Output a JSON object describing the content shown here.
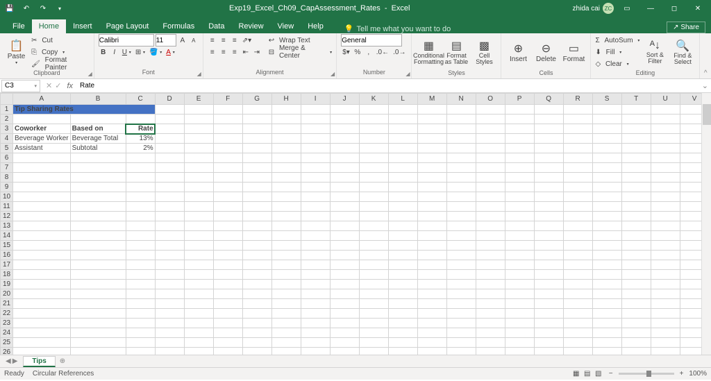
{
  "title_bar": {
    "filename": "Exp19_Excel_Ch09_CapAssessment_Rates",
    "app": "Excel",
    "user_name": "zhida cai",
    "user_initials": "ZC"
  },
  "menu": {
    "tabs": [
      "File",
      "Home",
      "Insert",
      "Page Layout",
      "Formulas",
      "Data",
      "Review",
      "View",
      "Help"
    ],
    "active": "Home",
    "tell_me": "Tell me what you want to do",
    "share": "Share"
  },
  "ribbon": {
    "clipboard": {
      "paste": "Paste",
      "cut": "Cut",
      "copy": "Copy",
      "format_painter": "Format Painter",
      "label": "Clipboard"
    },
    "font": {
      "name": "Calibri",
      "size": "11",
      "label": "Font"
    },
    "alignment": {
      "wrap": "Wrap Text",
      "merge": "Merge & Center",
      "label": "Alignment"
    },
    "number": {
      "format": "General",
      "label": "Number"
    },
    "styles": {
      "conditional": "Conditional Formatting",
      "format_as": "Format as Table",
      "cell": "Cell Styles",
      "label": "Styles"
    },
    "cells": {
      "insert": "Insert",
      "delete": "Delete",
      "format": "Format",
      "label": "Cells"
    },
    "editing": {
      "autosum": "AutoSum",
      "fill": "Fill",
      "clear": "Clear",
      "sort": "Sort & Filter",
      "find": "Find & Select",
      "label": "Editing"
    }
  },
  "formula_bar": {
    "cell_ref": "C3",
    "formula": "Rate"
  },
  "columns": [
    "A",
    "B",
    "C",
    "D",
    "E",
    "F",
    "G",
    "H",
    "I",
    "J",
    "K",
    "L",
    "M",
    "N",
    "O",
    "P",
    "Q",
    "R",
    "S",
    "T",
    "U",
    "V"
  ],
  "row_count": 28,
  "cells": {
    "title": "Tip Sharing Rates",
    "h_coworker": "Coworker",
    "h_based": "Based on",
    "h_rate": "Rate",
    "r1_c1": "Beverage Worker",
    "r1_c2": "Beverage Total",
    "r1_c3": "13%",
    "r2_c1": "Assistant",
    "r2_c2": "Subtotal",
    "r2_c3": "2%"
  },
  "sheet_tabs": {
    "active": "Tips"
  },
  "status": {
    "ready": "Ready",
    "circular": "Circular References",
    "zoom": "100%"
  }
}
